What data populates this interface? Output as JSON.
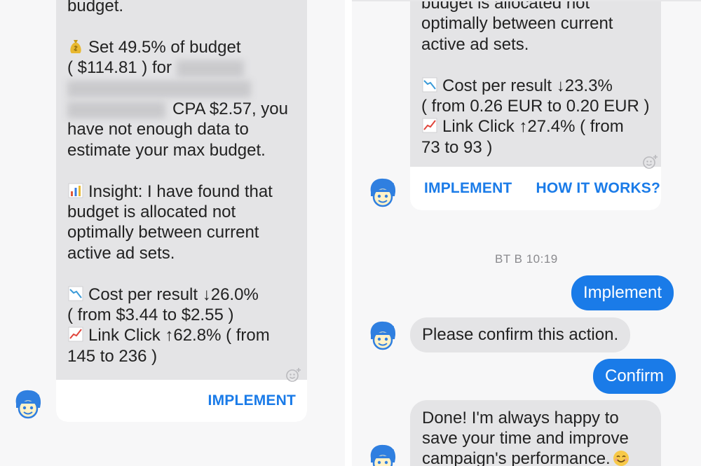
{
  "left": {
    "card": {
      "lines": [
        "budget.",
        "",
        "Set 49.5% of budget",
        "( $114.81 ) for",
        "",
        "CPA $2.57, you",
        "have not enough data to",
        "estimate your max budget.",
        "",
        "Insight: I have found that",
        "budget is allocated not",
        "optimally between current",
        "active ad sets.",
        "",
        "Cost per result ↓26.0%",
        "( from $3.44 to $2.55 )",
        "Link Click ↑62.8% ( from",
        "145 to 236 )"
      ],
      "implement_label": "IMPLEMENT"
    }
  },
  "right": {
    "card": {
      "lines": [
        "budget is allocated not",
        "optimally between current",
        "active ad sets.",
        "",
        "Cost per result ↓23.3%",
        "( from 0.26 EUR to 0.20 EUR )",
        "Link Click ↑27.4% ( from",
        "73 to 93 )"
      ],
      "implement_label": "IMPLEMENT",
      "how_label": "HOW IT WORKS?"
    },
    "timestamp": "BT B 10:19",
    "messages": {
      "user_implement": "Implement",
      "bot_confirm": "Please confirm this action.",
      "user_confirm": "Confirm",
      "bot_done_1": "Done! I'm always happy to",
      "bot_done_2": "save your time and improve",
      "bot_done_3": "campaign's performance."
    }
  },
  "colors": {
    "accent": "#1a7be8",
    "bubble_gray": "#e4e4e6",
    "panel_bg": "#f7f7f8"
  },
  "icons": [
    "money-bag-icon",
    "bar-chart-icon",
    "chart-down-icon",
    "chart-up-icon",
    "add-reaction-icon",
    "bot-avatar-icon",
    "smiling-face-icon"
  ]
}
